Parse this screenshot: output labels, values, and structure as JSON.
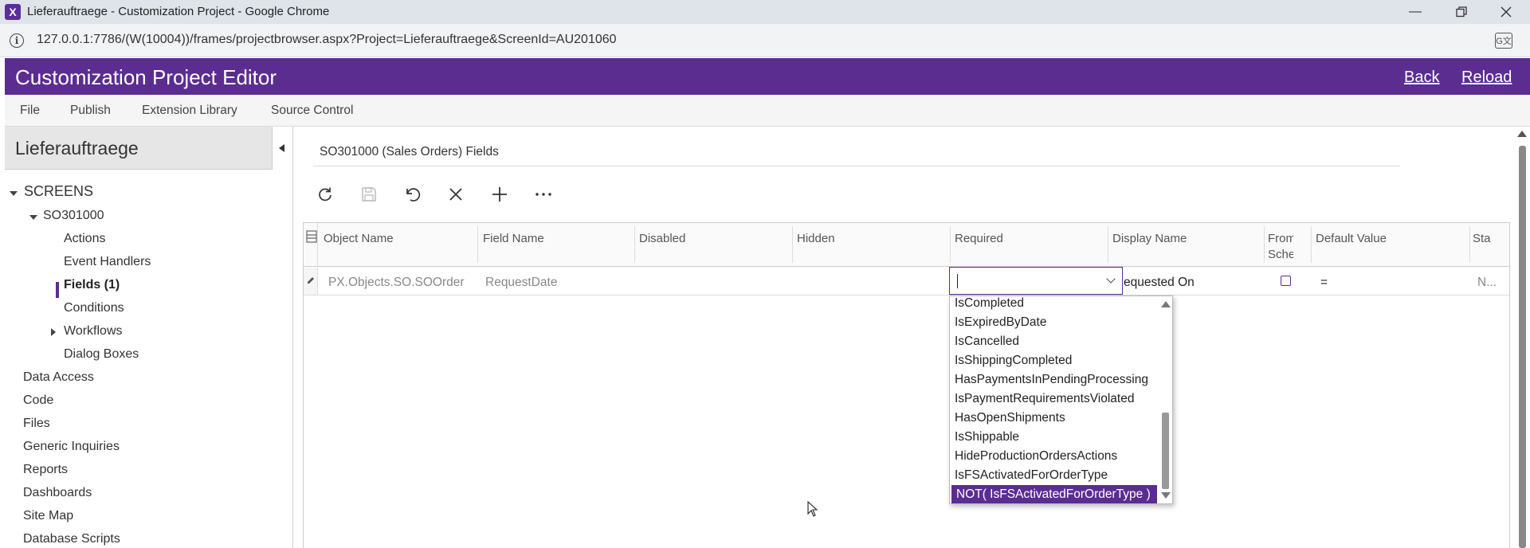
{
  "browser": {
    "window_title": "Lieferauftraege - Customization Project - Google Chrome",
    "url": "127.0.0.1:7786/(W(10004))/frames/projectbrowser.aspx?Project=Lieferauftraege&ScreenId=AU201060",
    "app_icon_letter": "X"
  },
  "header": {
    "title": "Customization Project Editor",
    "back_label": "Back",
    "reload_label": "Reload",
    "color": "#5b2d91"
  },
  "menu": {
    "file": "File",
    "publish": "Publish",
    "extension_library": "Extension Library",
    "source_control": "Source Control"
  },
  "sidebar": {
    "project_name": "Lieferauftraege",
    "screens_label": "SCREENS",
    "screen_id": "SO301000",
    "screen_children": [
      "Actions",
      "Event Handlers",
      "Fields (1)",
      "Conditions",
      "Workflows",
      "Dialog Boxes"
    ],
    "sections": [
      "Data Access",
      "Code",
      "Files",
      "Generic Inquiries",
      "Reports",
      "Dashboards",
      "Site Map",
      "Database Scripts"
    ]
  },
  "main": {
    "title": "SO301000 (Sales Orders) Fields",
    "toolbar": [
      "refresh-icon",
      "save-icon",
      "undo-icon",
      "close-icon",
      "add-icon",
      "more-icon"
    ],
    "columns": {
      "object_name": "Object Name",
      "field_name": "Field Name",
      "disabled": "Disabled",
      "hidden": "Hidden",
      "required": "Required",
      "display_name": "Display Name",
      "from_schema_1": "From",
      "from_schema_2": "Sche",
      "default_value": "Default Value",
      "status": "Sta"
    },
    "row": {
      "object_name": "PX.Objects.SO.SOOrder",
      "field_name": "RequestDate",
      "required": "",
      "display_name": "equested On",
      "from_schema": false,
      "default_value": "=",
      "status": "N..."
    }
  },
  "dropdown": {
    "options": [
      "IsCompleted",
      "IsExpiredByDate",
      "IsCancelled",
      "IsShippingCompleted",
      "HasPaymentsInPendingProcessing",
      "IsPaymentRequirementsViolated",
      "HasOpenShipments",
      "IsShippable",
      "HideProductionOrdersActions",
      "IsFSActivatedForOrderType",
      "NOT( IsFSActivatedForOrderType )"
    ],
    "selected_index": 10
  }
}
